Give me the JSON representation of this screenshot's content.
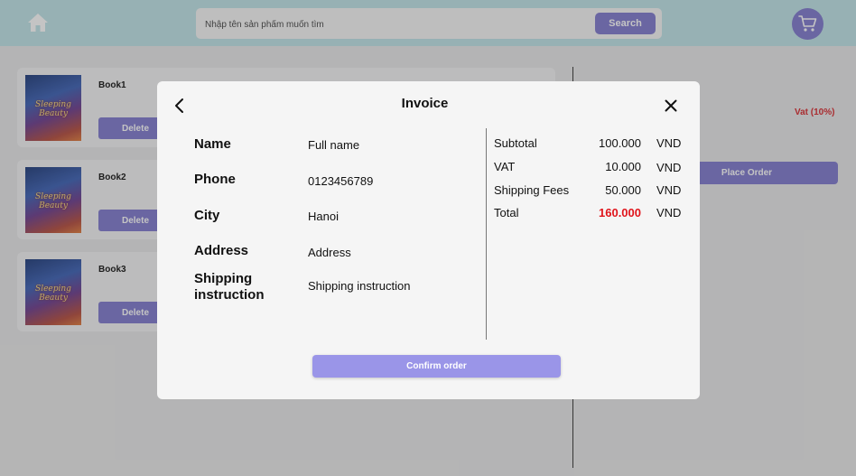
{
  "header": {
    "search_placeholder": "Nhập tên sản phẩm muốn tìm",
    "search_button": "Search"
  },
  "cart": {
    "items": [
      {
        "name": "Book1",
        "cover_text": "Sleeping Beauty",
        "delete_label": "Delete"
      },
      {
        "name": "Book2",
        "cover_text": "Sleeping Beauty",
        "delete_label": "Delete"
      },
      {
        "name": "Book3",
        "cover_text": "Sleeping Beauty",
        "delete_label": "Delete"
      }
    ],
    "vat_label": "Vat (10%)",
    "place_order_label": "Place Order"
  },
  "invoice": {
    "title": "Invoice",
    "fields": [
      {
        "label": "Name",
        "value": "Full name"
      },
      {
        "label": "Phone",
        "value": "0123456789"
      },
      {
        "label": "City",
        "value": "Hanoi"
      },
      {
        "label": "Address",
        "value": "Address"
      },
      {
        "label": "Shipping instruction",
        "value": "Shipping instruction"
      }
    ],
    "summary": [
      {
        "label": "Subtotal",
        "value": "100.000",
        "currency": "VND"
      },
      {
        "label": "VAT",
        "value": "10.000",
        "currency": "VND"
      },
      {
        "label": "Shipping Fees",
        "value": "50.000",
        "currency": "VND"
      },
      {
        "label": "Total",
        "value": "160.000",
        "currency": "VND"
      }
    ],
    "confirm_label": "Confirm order"
  },
  "colors": {
    "accent": "#7f79cf",
    "header_bg": "#bfe4e9",
    "total_red": "#e0141b",
    "vat_red": "#d8262b"
  }
}
